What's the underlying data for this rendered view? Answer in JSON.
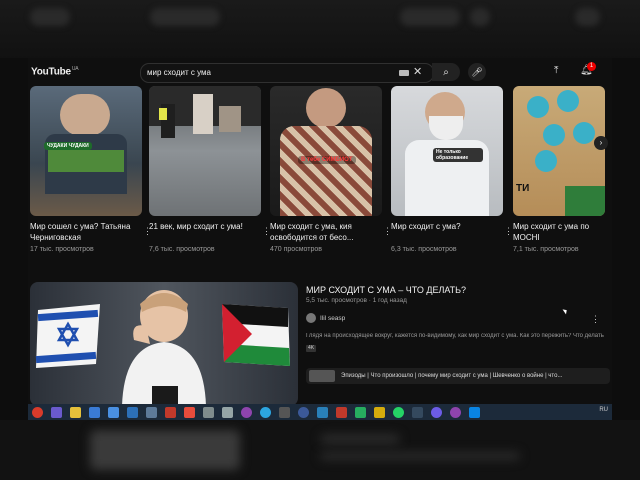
{
  "header": {
    "logo_text": "YouTube",
    "region": "UA",
    "search_value": "мир сходит с ума",
    "clear_icon": "close-icon",
    "search_icon": "search-icon",
    "mic_icon": "microphone-icon",
    "upload_icon": "upload-icon",
    "bell_icon": "bell-icon",
    "notification_count": "1"
  },
  "shorts": [
    {
      "title": "Мир сошел с ума? Татьяна Черниговская",
      "meta": "17 тыс. просмотров",
      "tag": "ЧУДАКИ ЧУДАКИ"
    },
    {
      "title": "21 век, мир сходит с ума!",
      "meta": "7,6 тыс. просмотров",
      "tag": ""
    },
    {
      "title": "Мир сходит с ума, кия освободится от бесо...",
      "meta": "470 просмотров",
      "tag": "В тебе СИМБИОТ"
    },
    {
      "title": "Мир сходит с ума?",
      "meta": "6,3 тыс. просмотров",
      "tag": "Не только образование"
    },
    {
      "title": "Мир сходит с ума по МОСНІ",
      "meta": "7,1 тыс. просмотров",
      "tag": "ТИ"
    }
  ],
  "video": {
    "title": "МИР СХОДИТ С УМА – ЧТО ДЕЛАТЬ?",
    "meta": "5,5 тыс. просмотров · 1 год назад",
    "channel": "Ilil seasp",
    "description": "Глядя на происходящее вокруг, кажется по-видимому, как мир сходит с ума. Как это пережить? Что делать",
    "badge": "4K",
    "chapter": "Эпизоды | Что произошло | почему мир сходит с ума | Шевченко о войне | что..."
  },
  "taskbar": {
    "tray_text": "RU"
  },
  "colors": {
    "background": "#0f0f0f",
    "accent_red": "#ff0000",
    "taskbar": "#1c2a3a"
  }
}
